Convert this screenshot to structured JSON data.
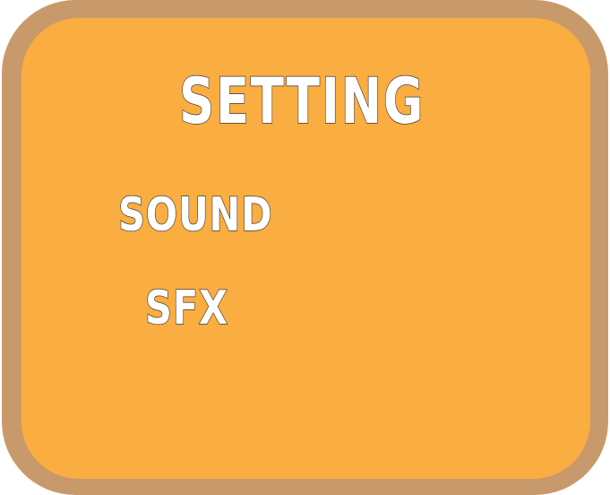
{
  "panel": {
    "title": "SETTING",
    "options": [
      {
        "label": "SOUND"
      },
      {
        "label": "SFX"
      }
    ]
  },
  "colors": {
    "frame": "#c89a6b",
    "panel_fill": "#faad40",
    "text_fill": "#ffffff",
    "text_outline": "#3a3a3a"
  }
}
